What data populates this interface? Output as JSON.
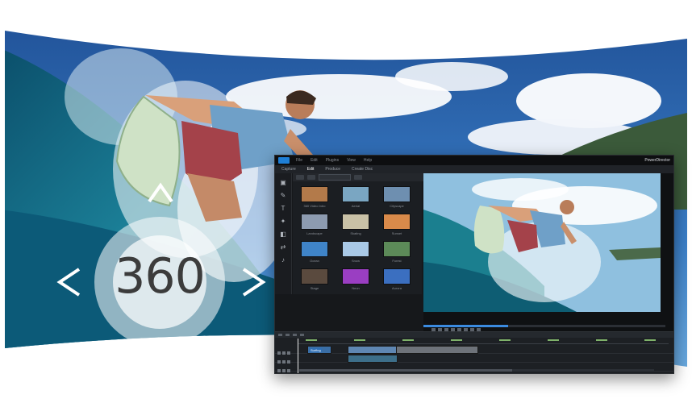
{
  "badge": {
    "label": "360",
    "arrows": [
      "chevron-up-icon",
      "chevron-down-icon",
      "chevron-left-icon",
      "chevron-right-icon"
    ]
  },
  "app": {
    "brand": "PowerDirector",
    "window_title": "",
    "menu": [
      "File",
      "Edit",
      "Plugins",
      "View",
      "Help"
    ],
    "tabs": [
      "Capture",
      "Edit",
      "Produce",
      "Create Disc"
    ],
    "library": {
      "items": [
        {
          "caption": "360 Video Intro",
          "thumb_color": "#b37a4a"
        },
        {
          "caption": "Aerial",
          "thumb_color": "#7aa6c2"
        },
        {
          "caption": "Cityscape",
          "thumb_color": "#6e8fb0"
        },
        {
          "caption": "Landscape",
          "thumb_color": "#8d9bb0"
        },
        {
          "caption": "Skating",
          "thumb_color": "#c9c1a6"
        },
        {
          "caption": "Sunset",
          "thumb_color": "#d98a4a"
        },
        {
          "caption": "Ocean",
          "thumb_color": "#3f84c8"
        },
        {
          "caption": "Snow",
          "thumb_color": "#a9c9e6"
        },
        {
          "caption": "Forest",
          "thumb_color": "#5c8a58"
        },
        {
          "caption": "Stage",
          "thumb_color": "#5a4a3e"
        },
        {
          "caption": "Neon",
          "thumb_color": "#9a3ec2"
        },
        {
          "caption": "Aurora",
          "thumb_color": "#3b6fc0"
        }
      ]
    },
    "timeline": {
      "clip_label": "Surfing"
    }
  },
  "colors": {
    "accent": "#1e7fd6",
    "ocean": "#1a6f8c",
    "sky": "#3f7fc4",
    "ui_bg": "#16181b"
  }
}
